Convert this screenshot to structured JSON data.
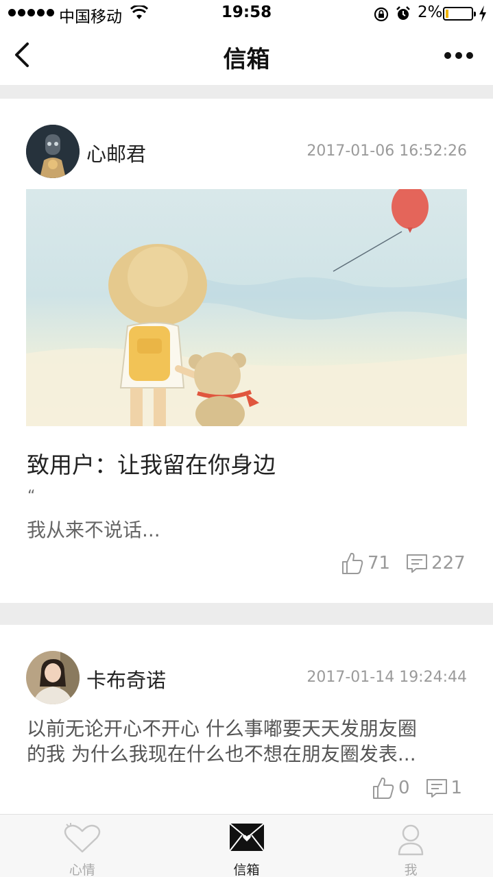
{
  "status_bar": {
    "carrier": "中国移动",
    "time": "19:58",
    "battery_percent_text": "2%",
    "battery_level": 0.02
  },
  "navbar": {
    "title": "信箱"
  },
  "posts": [
    {
      "author": "心邮君",
      "timestamp": "2017-01-06 16:52:26",
      "title": "致用户：让我留在你身边",
      "quote_mark": "“",
      "excerpt": "我从来不说话...",
      "likes": "71",
      "comments": "227"
    },
    {
      "author": "卡布奇诺",
      "timestamp": "2017-01-14 19:24:44",
      "body_line1": "以前无论开心不开心 什么事嘟要天天发朋友圈",
      "body_line2": "的我 为什么我现在什么也不想在朋友圈发表...",
      "likes": "0",
      "comments": "1"
    }
  ],
  "tabbar": {
    "tabs": [
      {
        "label": "心情",
        "icon": "heart-icon",
        "active": false
      },
      {
        "label": "信箱",
        "icon": "envelope-icon",
        "active": true
      },
      {
        "label": "我",
        "icon": "person-icon",
        "active": false
      }
    ]
  },
  "colors": {
    "separator": "#ececec",
    "muted_text": "#9a9a9a",
    "battery_fill": "#f0b400"
  }
}
